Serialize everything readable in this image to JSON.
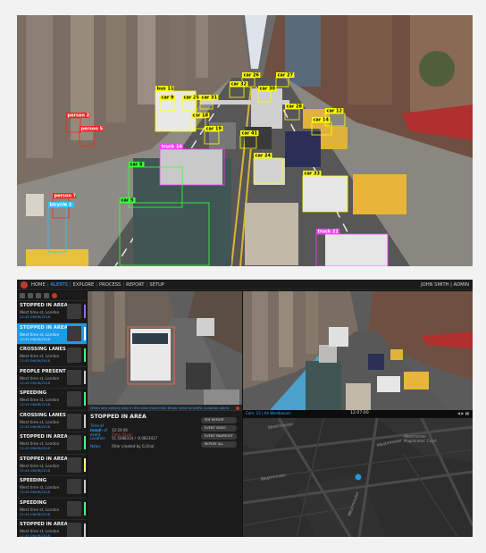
{
  "street_photo": {
    "detections": [
      {
        "label": "car 26",
        "color": "#ffff00"
      },
      {
        "label": "car 27",
        "color": "#ffff00"
      },
      {
        "label": "car 32",
        "color": "#ffff00"
      },
      {
        "label": "car 31",
        "color": "#ffff00"
      },
      {
        "label": "car 30",
        "color": "#ffff00"
      },
      {
        "label": "car 25",
        "color": "#ffff00"
      },
      {
        "label": "car 9",
        "color": "#ffff00"
      },
      {
        "label": "car 18",
        "color": "#ffff00"
      },
      {
        "label": "car 19",
        "color": "#ffff00"
      },
      {
        "label": "car 41",
        "color": "#ffff00"
      },
      {
        "label": "car 28",
        "color": "#ffff00"
      },
      {
        "label": "car 14",
        "color": "#ffff00"
      },
      {
        "label": "car 12",
        "color": "#ffff00"
      },
      {
        "label": "car 24",
        "color": "#ffff00"
      },
      {
        "label": "car 33",
        "color": "#ffff00"
      },
      {
        "label": "truck 14",
        "color": "#ff3bff"
      },
      {
        "label": "truck 21",
        "color": "#ff3bff"
      },
      {
        "label": "bus 11",
        "color": "#ffff00"
      },
      {
        "label": "person 2",
        "color": "#ff2020"
      },
      {
        "label": "person 5",
        "color": "#ff2020"
      },
      {
        "label": "person 7",
        "color": "#ff2020"
      },
      {
        "label": "bicycle 1",
        "color": "#2ec4ff"
      },
      {
        "label": "car 5",
        "color": "#3cff3c"
      },
      {
        "label": "car 8",
        "color": "#3cff3c"
      }
    ]
  },
  "dashboard": {
    "nav": [
      {
        "label": "HOME",
        "active": false
      },
      {
        "label": "ALERTS",
        "active": true
      },
      {
        "label": "EXPLORE",
        "active": false
      },
      {
        "label": "PROCESS",
        "active": false
      },
      {
        "label": "REPORT",
        "active": false
      },
      {
        "label": "SETUP",
        "active": false
      }
    ],
    "nav_sep": "|",
    "user": "JOHN SMITH | ADMIN",
    "alerts": [
      {
        "title": "STOPPED IN AREA",
        "location": "West time st, London",
        "time": "12:45 06/06/2018",
        "stripe": "#8a6cff",
        "selected": false
      },
      {
        "title": "STOPPED IN AREA",
        "location": "West time st, London",
        "time": "12:45 06/06/2018",
        "stripe": "#ffffff",
        "selected": true
      },
      {
        "title": "CROSSING LANES",
        "location": "West time st, London",
        "time": "12:45 06/06/2018",
        "stripe": "#3cff7a",
        "selected": false
      },
      {
        "title": "PEOPLE PRESENT",
        "location": "West time st, London",
        "time": "12:45 06/06/2018",
        "stripe": "#cccccc",
        "selected": false
      },
      {
        "title": "SPEEDING",
        "location": "West time st, London",
        "time": "12:45 06/06/2018",
        "stripe": "#3cff7a",
        "selected": false
      },
      {
        "title": "CROSSING LANES",
        "location": "West time st, London",
        "time": "12:45 06/06/2018",
        "stripe": "#cccccc",
        "selected": false
      },
      {
        "title": "STOPPED IN AREA",
        "location": "West time st, London",
        "time": "12:45 06/06/2018",
        "stripe": "#3cff7a",
        "selected": false
      },
      {
        "title": "STOPPED IN AREA",
        "location": "West time st, London",
        "time": "12:45 06/06/2018",
        "stripe": "#ffff66",
        "selected": false
      },
      {
        "title": "SPEEDING",
        "location": "West time st, London",
        "time": "12:45 06/06/2018",
        "stripe": "#cccccc",
        "selected": false
      },
      {
        "title": "SPEEDING",
        "location": "West time st, London",
        "time": "12:45 06/06/2018",
        "stripe": "#3cff7a",
        "selected": false
      },
      {
        "title": "STOPPED IN AREA",
        "location": "West time st, London",
        "time": "12:45 06/06/2018",
        "stripe": "#cccccc",
        "selected": false
      }
    ],
    "detail": {
      "banner": "When any vehicle stay in the area more than 60sec send to traffic violation alerts",
      "title": "STOPPED IN AREA",
      "rows": [
        {
          "key": "Time of event",
          "value": "12:24:06",
          "red": false
        },
        {
          "key": "Length of event",
          "value": "7min 35sec",
          "red": true
        },
        {
          "key": "Location",
          "value": "51.5088334 / -0.0823417",
          "red": false
        },
        {
          "key": "Notes",
          "value": "Filter created by G.Ghal",
          "red": false
        }
      ],
      "buttons": [
        "PDF REPORT",
        "EVENT VIDEO",
        "EVENT SNAPSHOT",
        "REPORT ALL"
      ]
    },
    "cam2_bar": {
      "camera": "Cam. 12 | A4 Westbound",
      "clock": "12:07:00",
      "controls": "◀ ▶ ▮▮"
    },
    "map": {
      "labels": [
        "Westminster",
        "Westminster",
        "Westminster",
        "Westminster",
        "Westminster Magistrates' Court"
      ]
    },
    "accent": "#1e9be8"
  }
}
